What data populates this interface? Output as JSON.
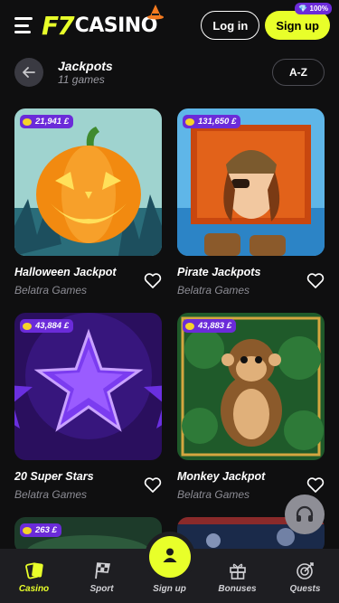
{
  "header": {
    "logo_prefix": "F7",
    "logo_name": "CASINO",
    "login_label": "Log in",
    "signup_label": "Sign up",
    "signup_badge": "💎 100%"
  },
  "page": {
    "title": "Jackpots",
    "subtitle": "11 games",
    "sort_label": "A-Z"
  },
  "games": [
    {
      "name": "Halloween Jackpot",
      "provider": "Belatra Games",
      "jackpot": "21,941 £"
    },
    {
      "name": "Pirate Jackpots",
      "provider": "Belatra Games",
      "jackpot": "131,650 £"
    },
    {
      "name": "20 Super Stars",
      "provider": "Belatra Games",
      "jackpot": "43,884 £"
    },
    {
      "name": "Monkey Jackpot",
      "provider": "Belatra Games",
      "jackpot": "43,883 £"
    },
    {
      "name": "",
      "provider": "",
      "jackpot": "263 £"
    },
    {
      "name": "",
      "provider": "",
      "jackpot": ""
    }
  ],
  "nav": [
    {
      "label": "Casino",
      "icon": "casino-icon",
      "active": true
    },
    {
      "label": "Sport",
      "icon": "checkered-flag-icon"
    },
    {
      "label": "Sign up",
      "icon": "user-icon"
    },
    {
      "label": "Bonuses",
      "icon": "gift-icon"
    },
    {
      "label": "Quests",
      "icon": "quest-icon"
    }
  ],
  "colors": {
    "accent": "#e8ff2a",
    "background": "#0f0f10",
    "badge": "#6b2bd9"
  }
}
